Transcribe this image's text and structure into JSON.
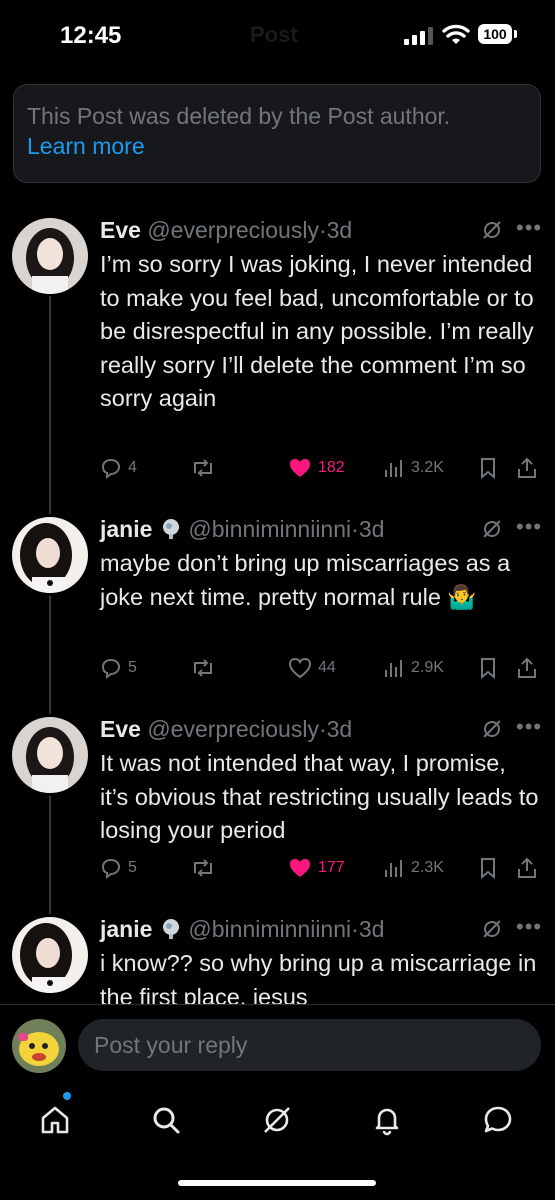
{
  "status": {
    "time": "12:45",
    "battery": "100",
    "title": "Post"
  },
  "deleted_notice": {
    "message": "This Post was deleted by the Post author.",
    "link": "Learn more"
  },
  "tweets": [
    {
      "name": "Eve",
      "handle": "@everpreciously",
      "sep": "·",
      "age": "3d",
      "text": "I’m so sorry I was joking, I never intended to make you feel bad, uncomfortable or to be disrespectful in any possible. I’m really really sorry I’ll delete the comment I’m so sorry again",
      "replies": "4",
      "likes": "182",
      "views": "3.2K",
      "liked": true
    },
    {
      "name": "janie",
      "handle": "@binniminniinni",
      "sep": "·",
      "age": "3d",
      "text": "maybe don’t bring up miscarriages as a joke next time. pretty normal rule 🤷‍♂️",
      "replies": "5",
      "likes": "44",
      "views": "2.9K",
      "liked": false
    },
    {
      "name": "Eve",
      "handle": "@everpreciously",
      "sep": "·",
      "age": "3d",
      "text": "It was not intended that way, I promise, it’s obvious that restricting usually leads to losing your period",
      "replies": "5",
      "likes": "177",
      "views": "2.3K",
      "liked": true
    },
    {
      "name": "janie",
      "handle": "@binniminniinni",
      "sep": "·",
      "age": "3d",
      "text": "i know?? so why bring up a miscarriage in the first place. jesus"
    }
  ],
  "reply_box": {
    "placeholder": "Post your reply"
  },
  "nav": [
    "home-icon",
    "search-icon",
    "grok-icon",
    "notifications-icon",
    "messages-icon"
  ],
  "colors": {
    "accent": "#1d9bf0",
    "like": "#f91880",
    "muted": "#71767b",
    "text": "#e7e9ea"
  }
}
